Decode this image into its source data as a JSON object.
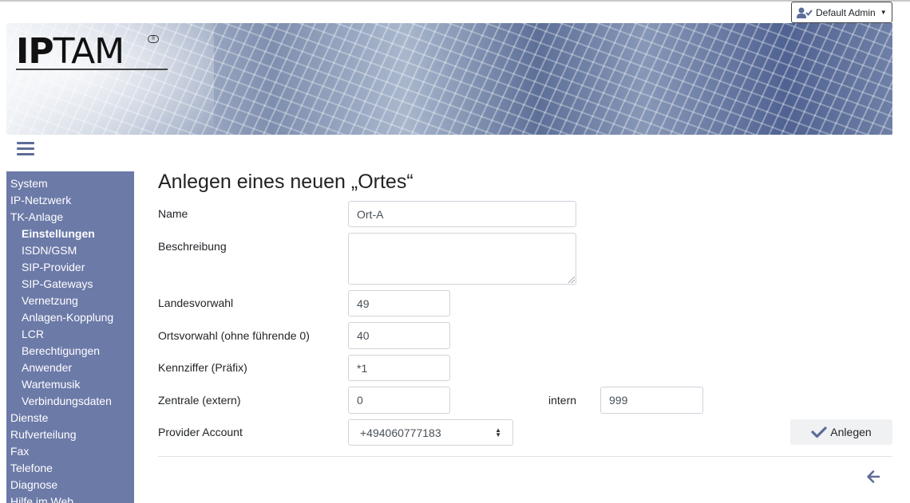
{
  "header": {
    "user_menu_label": "Default Admin",
    "logo_text_bold": "IP",
    "logo_text": "TAM",
    "logo_badge": "®"
  },
  "sidebar": {
    "items": [
      {
        "label": "System",
        "level": 0
      },
      {
        "label": "IP-Netzwerk",
        "level": 0
      },
      {
        "label": "TK-Anlage",
        "level": 0
      },
      {
        "label": "Einstellungen",
        "level": 1,
        "active": true
      },
      {
        "label": "ISDN/GSM",
        "level": 1
      },
      {
        "label": "SIP-Provider",
        "level": 1
      },
      {
        "label": "SIP-Gateways",
        "level": 1
      },
      {
        "label": "Vernetzung",
        "level": 1
      },
      {
        "label": "Anlagen-Kopplung",
        "level": 1
      },
      {
        "label": "LCR",
        "level": 1
      },
      {
        "label": "Berechtigungen",
        "level": 1
      },
      {
        "label": "Anwender",
        "level": 1
      },
      {
        "label": "Wartemusik",
        "level": 1
      },
      {
        "label": "Verbindungsdaten",
        "level": 1
      },
      {
        "label": "Dienste",
        "level": 0
      },
      {
        "label": "Rufverteilung",
        "level": 0
      },
      {
        "label": "Fax",
        "level": 0
      },
      {
        "label": "Telefone",
        "level": 0
      },
      {
        "label": "Diagnose",
        "level": 0
      },
      {
        "label": "Hilfe im Web",
        "level": 0
      }
    ]
  },
  "form": {
    "title": "Anlegen eines neuen „Ortes“",
    "name_label": "Name",
    "name_value": "Ort-A",
    "beschreibung_label": "Beschreibung",
    "beschreibung_value": "",
    "landesvorwahl_label": "Landesvorwahl",
    "landesvorwahl_value": "49",
    "ortsvorwahl_label": "Ortsvorwahl (ohne führende 0)",
    "ortsvorwahl_value": "40",
    "kennziffer_label": "Kennziffer (Präfix)",
    "kennziffer_value": "*1",
    "zentrale_label": "Zentrale (extern)",
    "zentrale_value": "0",
    "intern_label": "intern",
    "intern_value": "999",
    "provider_label": "Provider Account",
    "provider_value": "+494060777183",
    "submit_label": "Anlegen"
  },
  "colors": {
    "sidebar_bg": "#6c7aa8",
    "accent": "#5d6c98"
  },
  "icons": [
    "user-check-icon",
    "caret-down-icon",
    "hamburger-menu-icon",
    "check-icon",
    "arrow-left-icon",
    "select-arrows-icon"
  ]
}
